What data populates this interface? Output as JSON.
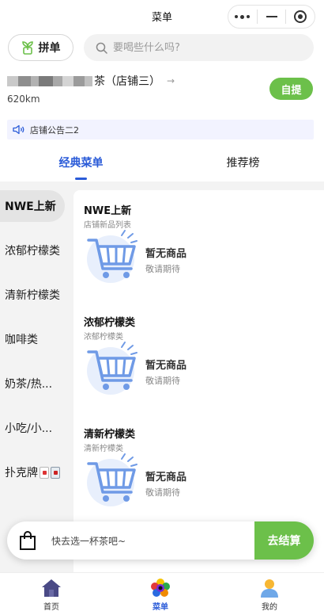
{
  "titlebar": {
    "title": "菜单"
  },
  "header": {
    "pindan_label": "拼单",
    "search_placeholder": "要喝些什么吗?"
  },
  "store": {
    "name": "茶（店铺三）",
    "distance": "620km",
    "pickup_label": "自提"
  },
  "notice": {
    "text": "店铺公告二2"
  },
  "tabs": [
    {
      "label": "经典菜单",
      "active": true
    },
    {
      "label": "推荐榜",
      "active": false
    }
  ],
  "categories": [
    {
      "label": "NWE上新",
      "active": true
    },
    {
      "label": "浓郁柠檬类"
    },
    {
      "label": "清新柠檬类"
    },
    {
      "label": "咖啡类"
    },
    {
      "label": "奶茶/热..."
    },
    {
      "label": "小吃/小..."
    },
    {
      "label": "扑克牌"
    }
  ],
  "sections": [
    {
      "title": "NWE上新",
      "subtitle": "店铺新品列表",
      "empty_title": "暂无商品",
      "empty_sub": "敬请期待"
    },
    {
      "title": "浓郁柠檬类",
      "subtitle": "浓郁柠檬类",
      "empty_title": "暂无商品",
      "empty_sub": "敬请期待"
    },
    {
      "title": "清新柠檬类",
      "subtitle": "清新柠檬类",
      "empty_title": "暂无商品",
      "empty_sub": "敬请期待"
    }
  ],
  "cart": {
    "hint": "快去选一杯茶吧~",
    "checkout_label": "去结算"
  },
  "nav": [
    {
      "label": "首页",
      "icon": "home-icon"
    },
    {
      "label": "菜单",
      "icon": "menu-icon",
      "active": true
    },
    {
      "label": "我的",
      "icon": "profile-icon"
    }
  ],
  "colors": {
    "accent_blue": "#2a5bd8",
    "accent_green": "#6cc04a"
  }
}
